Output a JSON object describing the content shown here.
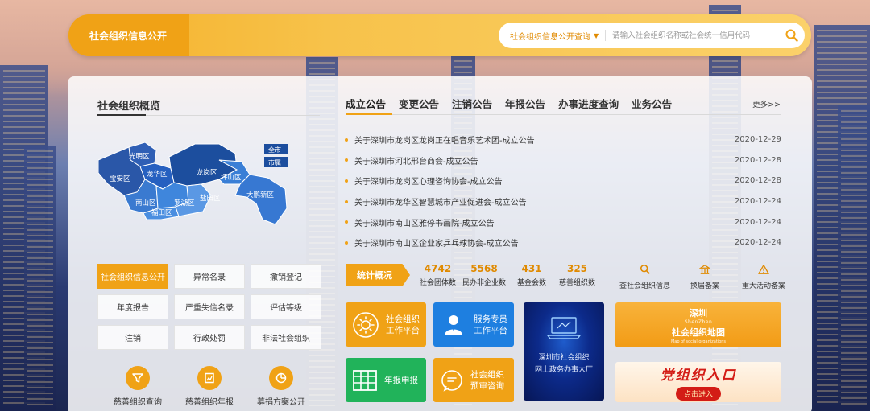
{
  "header": {
    "title": "社会组织信息公开",
    "search": {
      "scope": "社会组织信息公开查询",
      "placeholder": "请输入社会组织名称或社会统一信用代码"
    }
  },
  "overview": {
    "title": "社会组织概览",
    "map": {
      "districts": [
        "光明区",
        "宝安区",
        "龙华区",
        "龙岗区",
        "坪山区",
        "南山区",
        "罗湖区",
        "福田区",
        "盐田区",
        "大鹏新区"
      ],
      "level_buttons": [
        "全市",
        "市属"
      ]
    }
  },
  "tabs": {
    "items": [
      "成立公告",
      "变更公告",
      "注销公告",
      "年报公告",
      "办事进度查询",
      "业务公告"
    ],
    "active": 0,
    "more": "更多>>"
  },
  "notices": [
    {
      "title": "关于深圳市龙岗区龙岗正在唱音乐艺术团-成立公告",
      "date": "2020-12-29"
    },
    {
      "title": "关于深圳市河北邢台商会-成立公告",
      "date": "2020-12-28"
    },
    {
      "title": "关于深圳市龙岗区心理咨询协会-成立公告",
      "date": "2020-12-28"
    },
    {
      "title": "关于深圳市龙华区智慧城市产业促进会-成立公告",
      "date": "2020-12-24"
    },
    {
      "title": "关于深圳市南山区雅停书画院-成立公告",
      "date": "2020-12-24"
    },
    {
      "title": "关于深圳市南山区企业家乒乓球协会-成立公告",
      "date": "2020-12-24"
    }
  ],
  "grid_buttons": [
    "社会组织信息公开",
    "异常名录",
    "撤销登记",
    "年度报告",
    "严重失信名录",
    "评估等级",
    "注销",
    "行政处罚",
    "非法社会组织"
  ],
  "quick_links": [
    {
      "label": "慈善组织查询",
      "icon": "funnel-icon"
    },
    {
      "label": "慈善组织年报",
      "icon": "report-icon"
    },
    {
      "label": "募捐方案公开",
      "icon": "pie-chart-icon"
    }
  ],
  "stats": {
    "badge": "统计概况",
    "items": [
      {
        "num": "4742",
        "label": "社会团体数"
      },
      {
        "num": "5568",
        "label": "民办非企业数"
      },
      {
        "num": "431",
        "label": "基金会数"
      },
      {
        "num": "325",
        "label": "慈善组织数"
      }
    ],
    "links": [
      {
        "label": "查社会组织信息",
        "icon": "search-icon"
      },
      {
        "label": "换届备案",
        "icon": "building-icon"
      },
      {
        "label": "重大活动备案",
        "icon": "warning-icon"
      }
    ]
  },
  "tiles": {
    "work_platform": {
      "line1": "社会组织",
      "line2": "工作平台"
    },
    "service_platform": {
      "line1": "服务专员",
      "line2": "工作平台"
    },
    "gov_hall": {
      "line1": "深圳市社会组织",
      "line2": "网上政务办事大厅"
    },
    "map_banner": {
      "city": "深圳",
      "city_en": "ShenZhen",
      "title": "社会组织地图",
      "sub": "Map of social organizations"
    },
    "annual_report": {
      "label": "年报申报"
    },
    "pre_consult": {
      "line1": "社会组织",
      "line2": "预审咨询"
    },
    "party": {
      "title": "党组织入口",
      "button": "点击进入"
    }
  },
  "colors": {
    "accent": "#f0a216",
    "blue": "#1e7fe0",
    "green": "#21b35a",
    "map_blue": "#2f63b8"
  }
}
